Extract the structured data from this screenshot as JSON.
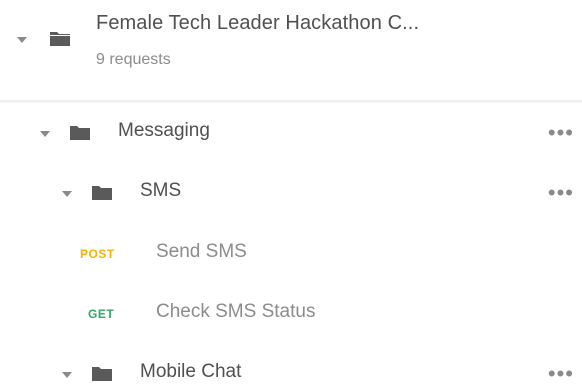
{
  "collection": {
    "title": "Female Tech Leader Hackathon C...",
    "subtitle": "9 requests"
  },
  "tree": {
    "messaging": {
      "label": "Messaging",
      "more": "•••"
    },
    "sms": {
      "label": "SMS",
      "more": "•••"
    },
    "requests": [
      {
        "method": "POST",
        "method_color": "#f4b400",
        "label": "Send SMS"
      },
      {
        "method": "GET",
        "method_color": "#2fa86a",
        "label": "Check SMS Status"
      }
    ],
    "mobile_chat": {
      "label": "Mobile Chat",
      "more": "•••"
    }
  },
  "colors": {
    "folder": "#5a5a5a",
    "caret": "#8a8a8a",
    "text_primary": "#505050",
    "text_secondary": "#8c8c8c"
  }
}
